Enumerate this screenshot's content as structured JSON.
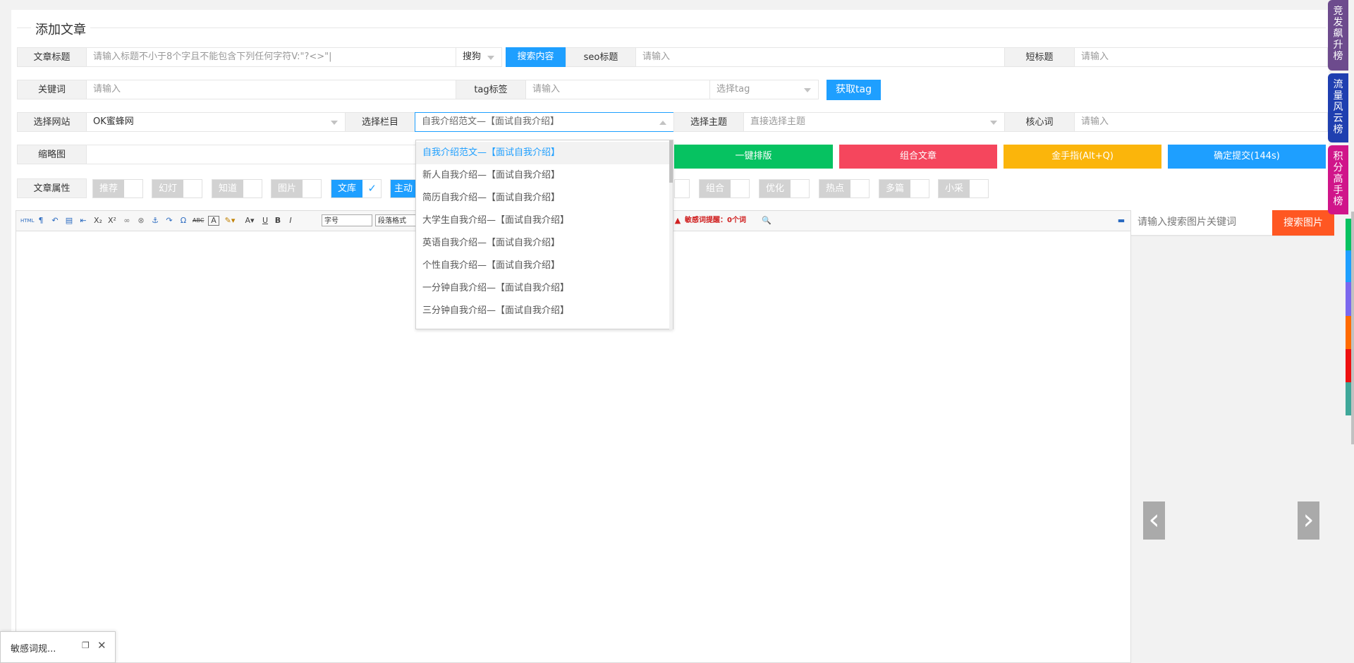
{
  "page_title": "添加文章",
  "row1": {
    "title_label": "文章标题",
    "title_placeholder": "请输入标题不小于8个字且不能包含下列任何字符V:\"?<>\"|",
    "engine_select": "搜狗",
    "search_button": "搜索内容",
    "seo_label": "seo标题",
    "seo_placeholder": "请输入",
    "short_label": "短标题",
    "short_placeholder": "请输入"
  },
  "row2": {
    "keyword_label": "关键词",
    "keyword_placeholder": "请输入",
    "tag_label": "tag标签",
    "tag_placeholder": "请输入",
    "tag_select": "选择tag",
    "get_tag_button": "获取tag"
  },
  "row3": {
    "site_label": "选择网站",
    "site_value": "OK蜜蜂网",
    "column_label": "选择栏目",
    "column_value": "自我介绍范文—【面试自我介绍】",
    "topic_label": "选择主题",
    "topic_placeholder": "直接选择主题",
    "core_label": "核心词",
    "core_placeholder": "请输入"
  },
  "row4": {
    "thumb_label": "缩略图",
    "buttons": [
      "一键排版",
      "组合文章",
      "金手指(Alt+Q)",
      "确定提交(144s)"
    ]
  },
  "row5": {
    "attr_label": "文章属性",
    "switches": [
      {
        "label": "推荐",
        "on": false
      },
      {
        "label": "幻灯",
        "on": false
      },
      {
        "label": "知道",
        "on": false
      },
      {
        "label": "图片",
        "on": false
      },
      {
        "label": "文库",
        "on": true
      },
      {
        "label": "主动",
        "on": true
      },
      {
        "label": "组合",
        "on": false
      },
      {
        "label": "优化",
        "on": false
      },
      {
        "label": "热点",
        "on": false
      },
      {
        "label": "多篇",
        "on": false
      },
      {
        "label": "小采",
        "on": false
      }
    ]
  },
  "dropdown_items": [
    "自我介绍范文—【面试自我介绍】",
    "新人自我介绍—【面试自我介绍】",
    "简历自我介绍—【面试自我介绍】",
    "大学生自我介绍—【面试自我介绍】",
    "英语自我介绍—【面试自我介绍】",
    "个性自我介绍—【面试自我介绍】",
    "一分钟自我介绍—【面试自我介绍】",
    "三分钟自我介绍—【面试自我介绍】"
  ],
  "editor": {
    "html_label": "HTML",
    "font_size_select": "字号",
    "para_select": "段落格式",
    "sensitive_notice": "敏感词提醒：0个词"
  },
  "image_search": {
    "placeholder": "请输入搜索图片关键词",
    "button": "搜索图片"
  },
  "side_tabs": [
    {
      "label": "竞发飙升榜",
      "color": "#6d4b8d"
    },
    {
      "label": "流量风云榜",
      "color": "#1f3fb0"
    },
    {
      "label": "积分高手榜",
      "color": "#d0158a"
    }
  ],
  "minimized_window": {
    "title": "敏感词规..."
  }
}
